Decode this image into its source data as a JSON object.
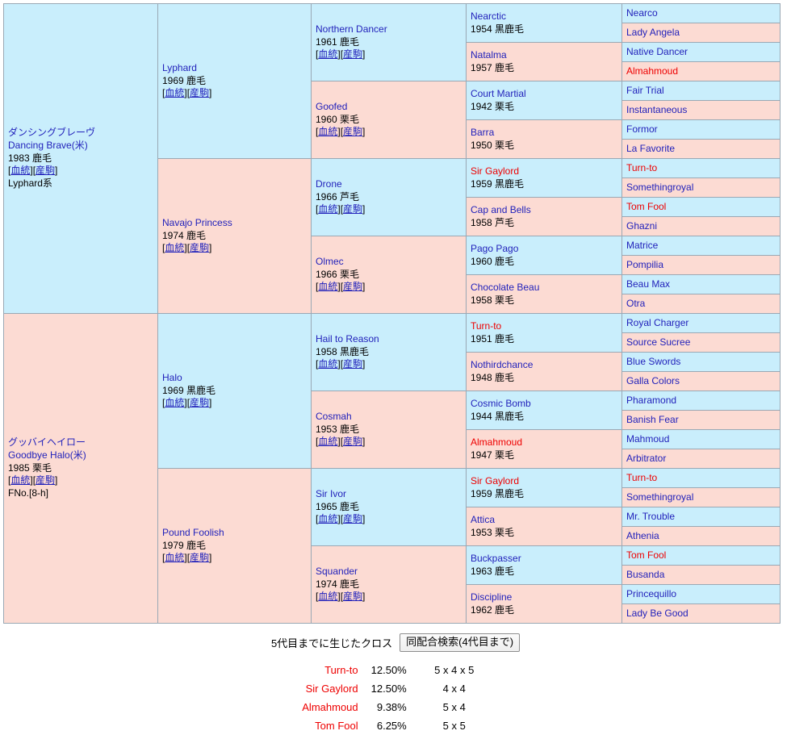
{
  "colors": {
    "sire_bg": "#c9eefc",
    "dam_bg": "#fcdbd3",
    "name_link": "#2222bb",
    "cross_red": "#ee0000",
    "border": "#9aa8b4"
  },
  "labels": {
    "blood_link": "血統",
    "progeny_link": "産駒",
    "bracket_open": "[",
    "bracket_close": "]"
  },
  "subject": {
    "name_jp": "ダンシングブレーヴ",
    "name_en": "Dancing Brave(米)",
    "info": "1983 鹿毛",
    "links": "[血統][産駒]",
    "line": "Lyphard系"
  },
  "dam": {
    "name_jp": "グッバイヘイロー",
    "name_en": "Goodbye Halo(米)",
    "info": "1985 栗毛",
    "links": "[血統][産駒]",
    "fno": "FNo.[8-h]"
  },
  "gen2": [
    {
      "name": "Lyphard",
      "info": "1969 鹿毛",
      "links": "[血統][産駒]",
      "bg": "blue",
      "cross": false
    },
    {
      "name": "Navajo Princess",
      "info": "1974 鹿毛",
      "links": "[血統][産駒]",
      "bg": "pink",
      "cross": false
    },
    {
      "name": "Halo",
      "info": "1969 黒鹿毛",
      "links": "[血統][産駒]",
      "bg": "blue",
      "cross": false
    },
    {
      "name": "Pound Foolish",
      "info": "1979 鹿毛",
      "links": "[血統][産駒]",
      "bg": "pink",
      "cross": false
    }
  ],
  "gen3": [
    {
      "name": "Northern Dancer",
      "info": "1961 鹿毛",
      "links": "[血統][産駒]",
      "bg": "blue",
      "cross": false
    },
    {
      "name": "Goofed",
      "info": "1960 栗毛",
      "links": "[血統][産駒]",
      "bg": "pink",
      "cross": false
    },
    {
      "name": "Drone",
      "info": "1966 芦毛",
      "links": "[血統][産駒]",
      "bg": "blue",
      "cross": false
    },
    {
      "name": "Olmec",
      "info": "1966 栗毛",
      "links": "[血統][産駒]",
      "bg": "pink",
      "cross": false
    },
    {
      "name": "Hail to Reason",
      "info": "1958 黒鹿毛",
      "links": "[血統][産駒]",
      "bg": "blue",
      "cross": false
    },
    {
      "name": "Cosmah",
      "info": "1953 鹿毛",
      "links": "[血統][産駒]",
      "bg": "pink",
      "cross": false
    },
    {
      "name": "Sir Ivor",
      "info": "1965 鹿毛",
      "links": "[血統][産駒]",
      "bg": "blue",
      "cross": false
    },
    {
      "name": "Squander",
      "info": "1974 鹿毛",
      "links": "[血統][産駒]",
      "bg": "pink",
      "cross": false
    }
  ],
  "gen4": [
    {
      "name": "Nearctic",
      "info": "1954 黒鹿毛",
      "bg": "blue",
      "cross": false
    },
    {
      "name": "Natalma",
      "info": "1957 鹿毛",
      "bg": "pink",
      "cross": false
    },
    {
      "name": "Court Martial",
      "info": "1942 栗毛",
      "bg": "blue",
      "cross": false
    },
    {
      "name": "Barra",
      "info": "1950 栗毛",
      "bg": "pink",
      "cross": false
    },
    {
      "name": "Sir Gaylord",
      "info": "1959 黒鹿毛",
      "bg": "blue",
      "cross": true
    },
    {
      "name": "Cap and Bells",
      "info": "1958 芦毛",
      "bg": "pink",
      "cross": false
    },
    {
      "name": "Pago Pago",
      "info": "1960 鹿毛",
      "bg": "blue",
      "cross": false
    },
    {
      "name": "Chocolate Beau",
      "info": "1958 栗毛",
      "bg": "pink",
      "cross": false
    },
    {
      "name": "Turn-to",
      "info": "1951 鹿毛",
      "bg": "blue",
      "cross": true
    },
    {
      "name": "Nothirdchance",
      "info": "1948 鹿毛",
      "bg": "pink",
      "cross": false
    },
    {
      "name": "Cosmic Bomb",
      "info": "1944 黒鹿毛",
      "bg": "blue",
      "cross": false
    },
    {
      "name": "Almahmoud",
      "info": "1947 栗毛",
      "bg": "pink",
      "cross": true
    },
    {
      "name": "Sir Gaylord",
      "info": "1959 黒鹿毛",
      "bg": "blue",
      "cross": true
    },
    {
      "name": "Attica",
      "info": "1953 栗毛",
      "bg": "pink",
      "cross": false
    },
    {
      "name": "Buckpasser",
      "info": "1963 鹿毛",
      "bg": "blue",
      "cross": false
    },
    {
      "name": "Discipline",
      "info": "1962 鹿毛",
      "bg": "pink",
      "cross": false
    }
  ],
  "gen5": [
    {
      "name": "Nearco",
      "bg": "blue",
      "cross": false
    },
    {
      "name": "Lady Angela",
      "bg": "pink",
      "cross": false
    },
    {
      "name": "Native Dancer",
      "bg": "blue",
      "cross": false
    },
    {
      "name": "Almahmoud",
      "bg": "pink",
      "cross": true
    },
    {
      "name": "Fair Trial",
      "bg": "blue",
      "cross": false
    },
    {
      "name": "Instantaneous",
      "bg": "pink",
      "cross": false
    },
    {
      "name": "Formor",
      "bg": "blue",
      "cross": false
    },
    {
      "name": "La Favorite",
      "bg": "pink",
      "cross": false
    },
    {
      "name": "Turn-to",
      "bg": "blue",
      "cross": true
    },
    {
      "name": "Somethingroyal",
      "bg": "pink",
      "cross": false
    },
    {
      "name": "Tom Fool",
      "bg": "blue",
      "cross": true
    },
    {
      "name": "Ghazni",
      "bg": "pink",
      "cross": false
    },
    {
      "name": "Matrice",
      "bg": "blue",
      "cross": false
    },
    {
      "name": "Pompilia",
      "bg": "pink",
      "cross": false
    },
    {
      "name": "Beau Max",
      "bg": "blue",
      "cross": false
    },
    {
      "name": "Otra",
      "bg": "pink",
      "cross": false
    },
    {
      "name": "Royal Charger",
      "bg": "blue",
      "cross": false
    },
    {
      "name": "Source Sucree",
      "bg": "pink",
      "cross": false
    },
    {
      "name": "Blue Swords",
      "bg": "blue",
      "cross": false
    },
    {
      "name": "Galla Colors",
      "bg": "pink",
      "cross": false
    },
    {
      "name": "Pharamond",
      "bg": "blue",
      "cross": false
    },
    {
      "name": "Banish Fear",
      "bg": "pink",
      "cross": false
    },
    {
      "name": "Mahmoud",
      "bg": "blue",
      "cross": false
    },
    {
      "name": "Arbitrator",
      "bg": "pink",
      "cross": false
    },
    {
      "name": "Turn-to",
      "bg": "blue",
      "cross": true
    },
    {
      "name": "Somethingroyal",
      "bg": "pink",
      "cross": false
    },
    {
      "name": "Mr. Trouble",
      "bg": "blue",
      "cross": false
    },
    {
      "name": "Athenia",
      "bg": "pink",
      "cross": false
    },
    {
      "name": "Tom Fool",
      "bg": "blue",
      "cross": true
    },
    {
      "name": "Busanda",
      "bg": "pink",
      "cross": false
    },
    {
      "name": "Princequillo",
      "bg": "blue",
      "cross": false
    },
    {
      "name": "Lady Be Good",
      "bg": "pink",
      "cross": false
    }
  ],
  "footer": {
    "cross_label": "5代目までに生じたクロス",
    "search_button": "同配合検索(4代目まで)",
    "crosses": [
      {
        "name": "Turn-to",
        "pct": "12.50%",
        "gens": "5 x 4 x 5"
      },
      {
        "name": "Sir Gaylord",
        "pct": "12.50%",
        "gens": "4 x 4"
      },
      {
        "name": "Almahmoud",
        "pct": "9.38%",
        "gens": "5 x 4"
      },
      {
        "name": "Tom Fool",
        "pct": "6.25%",
        "gens": "5 x 5"
      }
    ]
  }
}
